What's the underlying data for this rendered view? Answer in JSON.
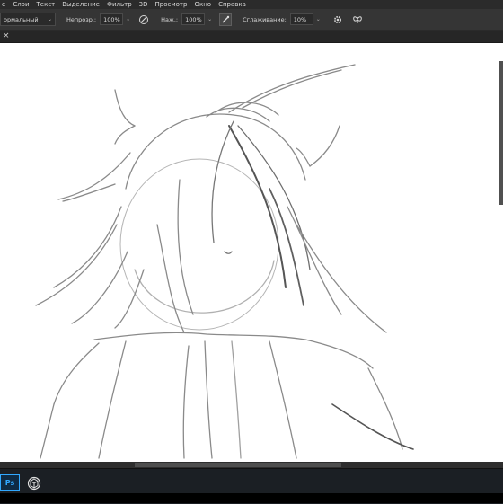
{
  "menu": {
    "items": [
      "Слои",
      "Текст",
      "Выделение",
      "Фильтр",
      "3D",
      "Просмотр",
      "Окно",
      "Справка"
    ],
    "cut_item": "е"
  },
  "options": {
    "mode_value": "ормальный",
    "opacity_label": "Непрозр.:",
    "opacity_value": "100%",
    "pressure_label": "Наж.:",
    "pressure_value": "100%",
    "smoothing_label": "Сглаживание:",
    "smoothing_value": "10%"
  },
  "icons": {
    "pressure_opacity": "pen-pressure-icon",
    "airbrush": "airbrush-icon",
    "settings": "gear-icon",
    "symmetry": "butterfly-icon",
    "close_tab": "close-icon",
    "photoshop_app": "photoshop-icon",
    "cube_app": "cube-icon"
  },
  "tab": {
    "close": "×"
  },
  "taskbar": {
    "ps_label": "Ps"
  },
  "colors": {
    "accent": "#31a8ff",
    "sketch_stroke": "#8a8a8a",
    "canvas": "#ffffff"
  }
}
